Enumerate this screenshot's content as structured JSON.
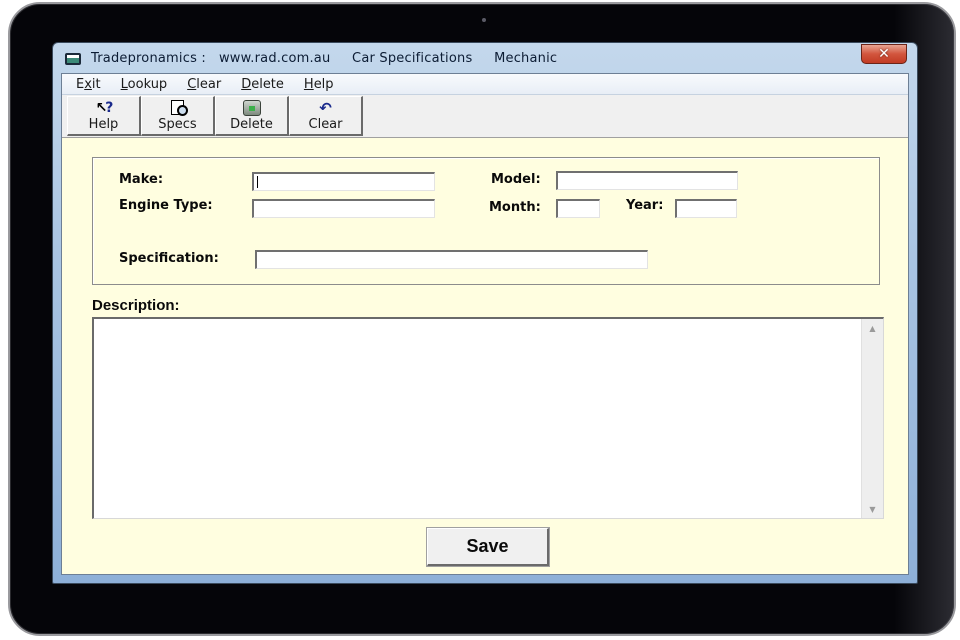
{
  "window": {
    "title": "Tradepronamics :   www.rad.com.au     Car Specifications     Mechanic",
    "close_label": "✕"
  },
  "menu": {
    "items": [
      {
        "label": "Exit",
        "mnemonic_index": 1
      },
      {
        "label": "Lookup",
        "mnemonic_index": 0
      },
      {
        "label": "Clear",
        "mnemonic_index": 0
      },
      {
        "label": "Delete",
        "mnemonic_index": 0
      },
      {
        "label": "Help",
        "mnemonic_index": 0
      }
    ]
  },
  "toolbar": {
    "buttons": [
      {
        "label": "Help",
        "icon": "help-pointer-icon"
      },
      {
        "label": "Specs",
        "icon": "document-magnifier-icon"
      },
      {
        "label": "Delete",
        "icon": "trash-icon"
      },
      {
        "label": "Clear",
        "icon": "undo-arrow-icon"
      }
    ]
  },
  "form": {
    "make": {
      "label": "Make:",
      "value": ""
    },
    "model": {
      "label": "Model:",
      "value": ""
    },
    "engine_type": {
      "label": "Engine Type:",
      "value": ""
    },
    "month": {
      "label": "Month:",
      "value": ""
    },
    "year": {
      "label": "Year:",
      "value": ""
    },
    "specification": {
      "label": "Specification:",
      "value": ""
    },
    "description": {
      "label": "Description:",
      "value": ""
    }
  },
  "actions": {
    "save_label": "Save"
  },
  "icons": {
    "help_glyph": "↖",
    "help_q": "?",
    "undo_glyph": "↶",
    "scroll_up": "▲",
    "scroll_down": "▼"
  }
}
